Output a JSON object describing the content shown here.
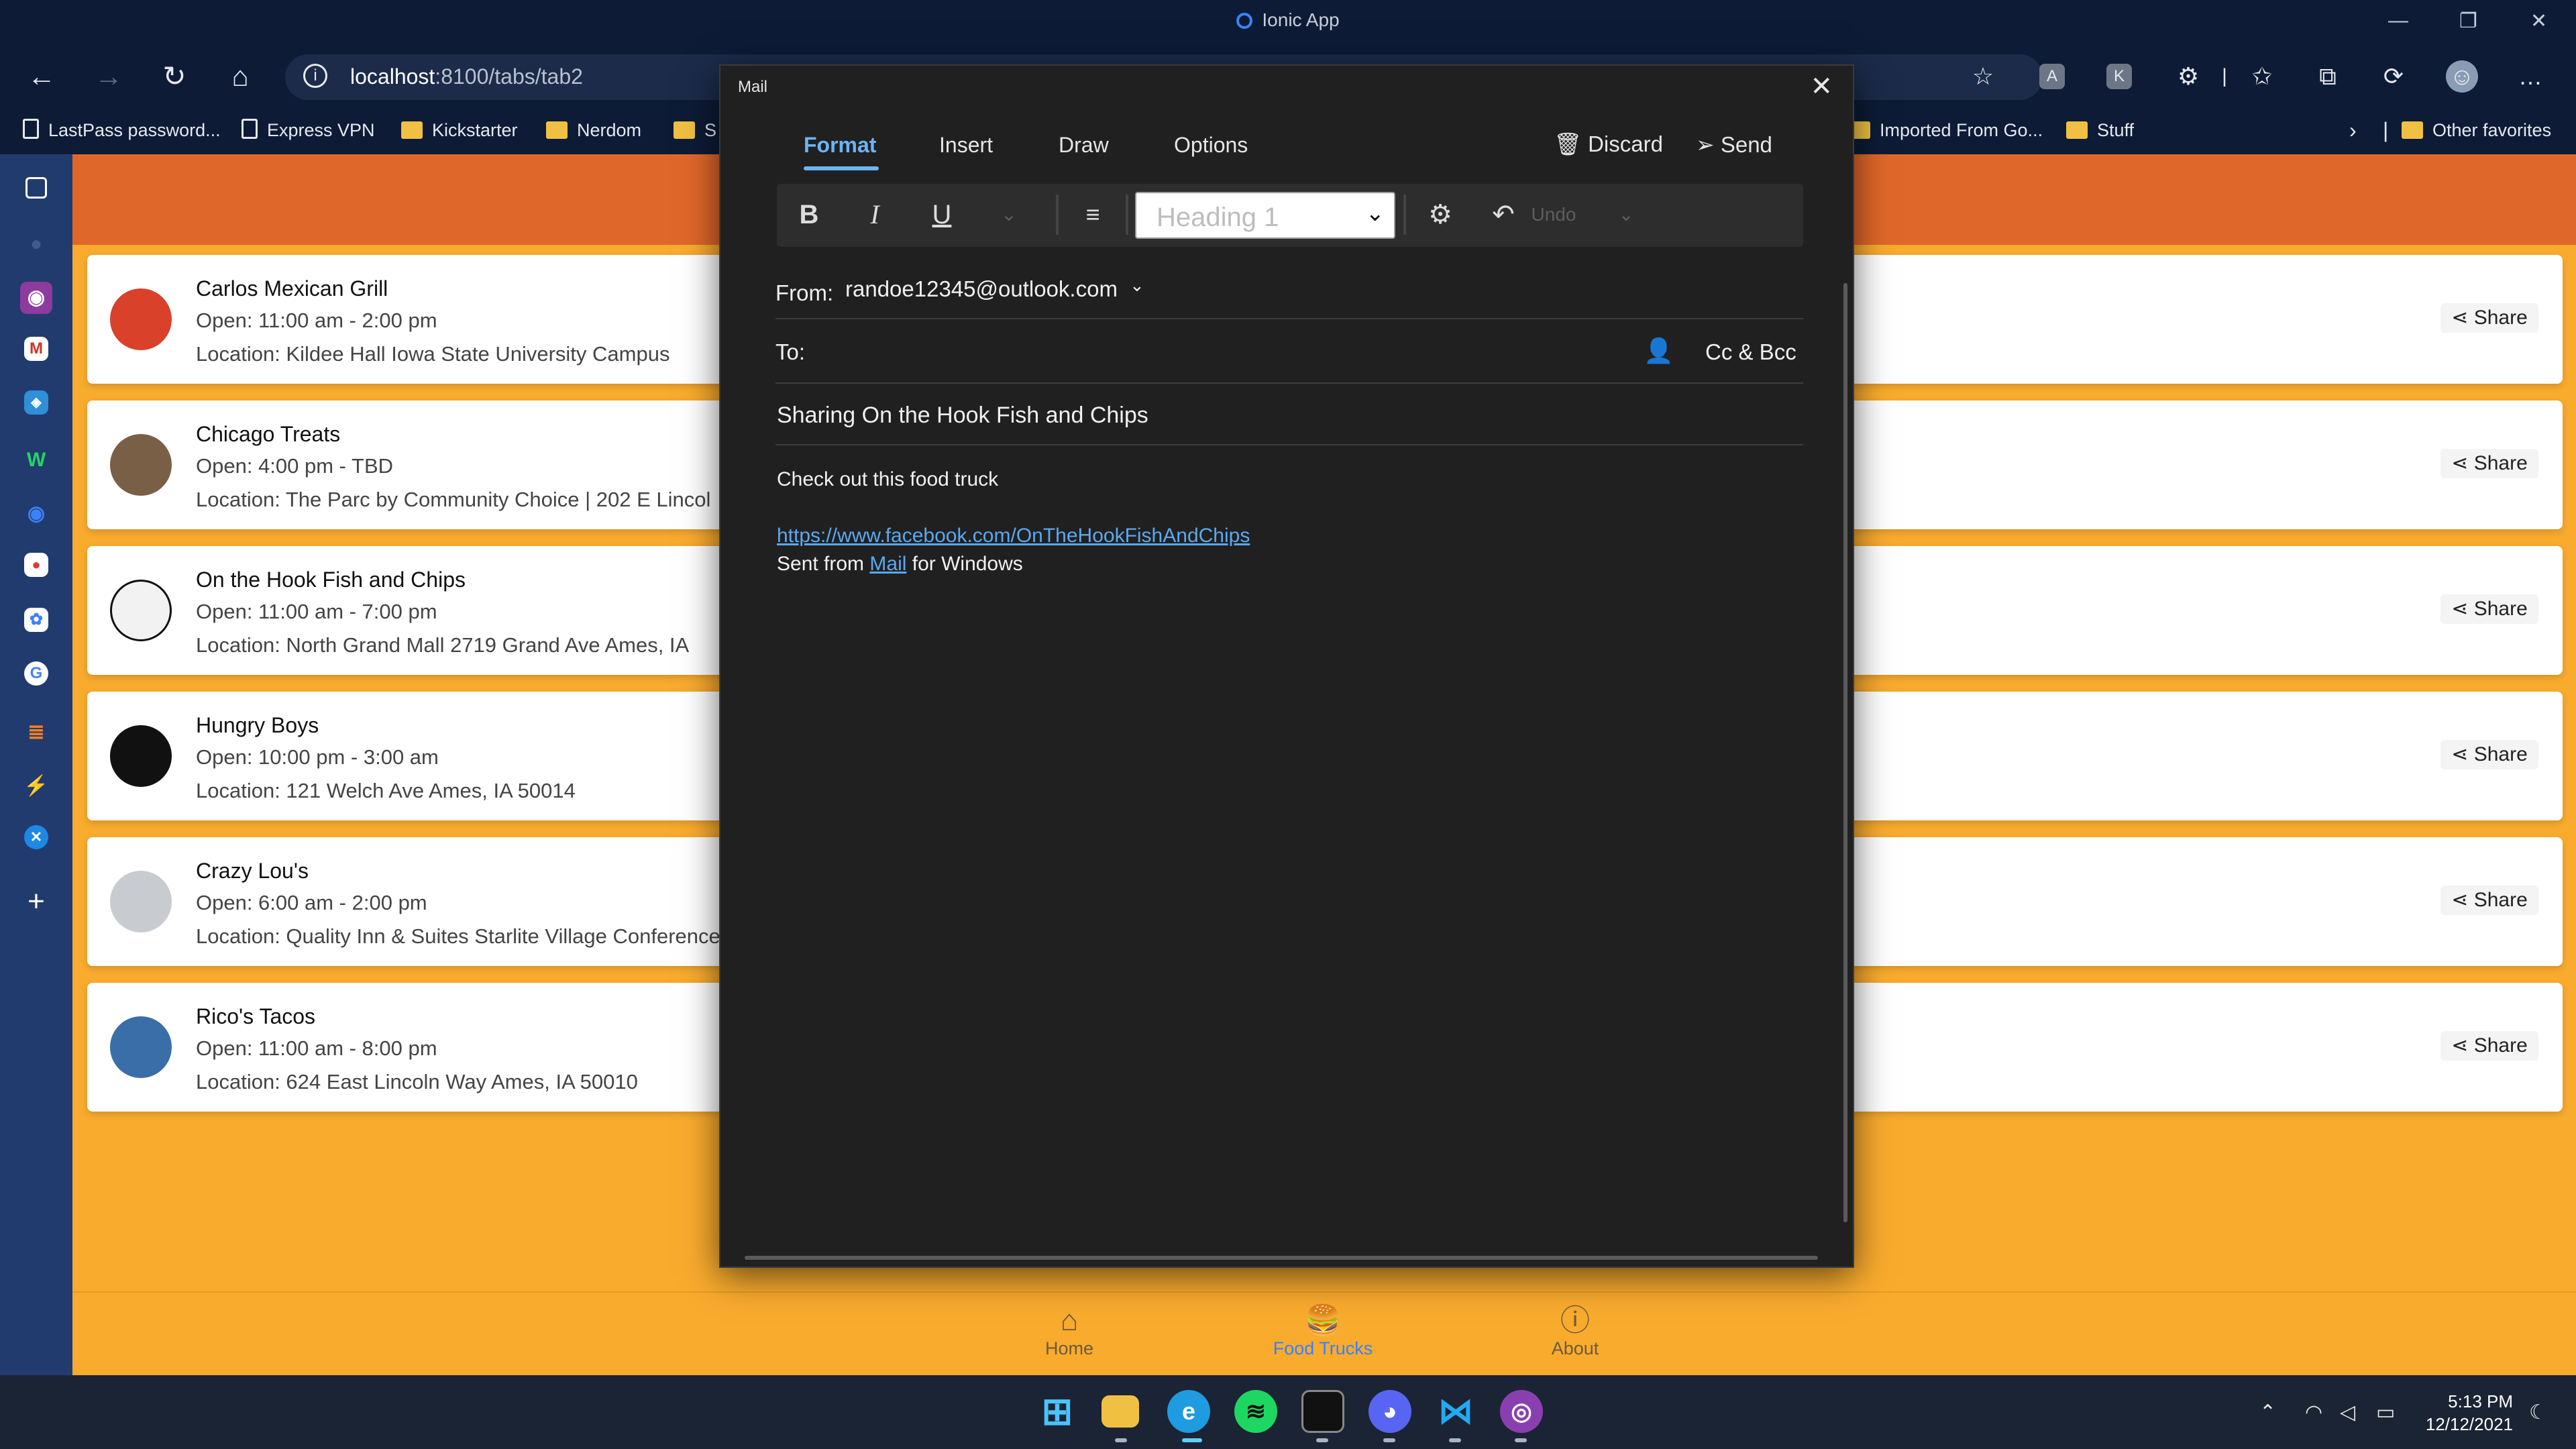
{
  "window": {
    "title": "Ionic App"
  },
  "browser": {
    "url_host": "localhost",
    "url_path": ":8100/tabs/tab2"
  },
  "favorites": [
    {
      "label": "LastPass password...",
      "icon": "page"
    },
    {
      "label": "Express VPN",
      "icon": "page"
    },
    {
      "label": "Kickstarter",
      "icon": "folder"
    },
    {
      "label": "Nerdom",
      "icon": "folder"
    },
    {
      "label": "S",
      "icon": "folder"
    },
    {
      "label": "Imported From Go...",
      "icon": "folder"
    },
    {
      "label": "Stuff",
      "icon": "folder"
    },
    {
      "label": "Other favorites",
      "icon": "folder"
    }
  ],
  "trucks": [
    {
      "name": "Carlos Mexican Grill",
      "hours": "Open: 11:00 am - 2:00 pm",
      "location": "Location: Kildee Hall Iowa State University Campus",
      "share": "Share"
    },
    {
      "name": "Chicago Treats",
      "hours": "Open: 4:00 pm - TBD",
      "location": "Location: The Parc by Community Choice | 202 E Lincol",
      "share": "Share"
    },
    {
      "name": "On the Hook Fish and Chips",
      "hours": "Open: 11:00 am - 7:00 pm",
      "location": "Location: North Grand Mall 2719 Grand Ave Ames, IA",
      "share": "Share"
    },
    {
      "name": "Hungry Boys",
      "hours": "Open: 10:00 pm - 3:00 am",
      "location": "Location: 121 Welch Ave Ames, IA 50014",
      "share": "Share"
    },
    {
      "name": "Crazy Lou's",
      "hours": "Open: 6:00 am - 2:00 pm",
      "location": "Location: Quality Inn & Suites Starlite Village Conference",
      "share": "Share"
    },
    {
      "name": "Rico's Tacos",
      "hours": "Open: 11:00 am - 8:00 pm",
      "location": "Location: 624 East Lincoln Way Ames, IA 50010",
      "share": "Share"
    }
  ],
  "tabs": [
    {
      "label": "Home",
      "icon": "home-icon",
      "active": false
    },
    {
      "label": "Food Trucks",
      "icon": "fastfood-icon",
      "active": true
    },
    {
      "label": "About",
      "icon": "help-circle-icon",
      "active": false
    }
  ],
  "mail": {
    "title": "Mail",
    "tabs": [
      "Format",
      "Insert",
      "Draw",
      "Options"
    ],
    "discard": "Discard",
    "send": "Send",
    "heading": "Heading 1",
    "undo": "Undo",
    "from_label": "From:",
    "from_value": "randoe12345@outlook.com",
    "to_label": "To:",
    "cc_bcc": "Cc & Bcc",
    "subject": "Sharing On the Hook Fish and Chips",
    "body": "Check out this food truck",
    "link": "https://www.facebook.com/OnTheHookFishAndChips",
    "sig_pre": "Sent from ",
    "sig_link": "Mail",
    "sig_post": " for Windows"
  },
  "clock": {
    "time": "5:13 PM",
    "date": "12/12/2021"
  },
  "colors": {
    "header": "#e0672a",
    "app_bg": "#f9ab2e",
    "active_tab": "#3880ff",
    "mail_accent": "#6cb4f5"
  }
}
